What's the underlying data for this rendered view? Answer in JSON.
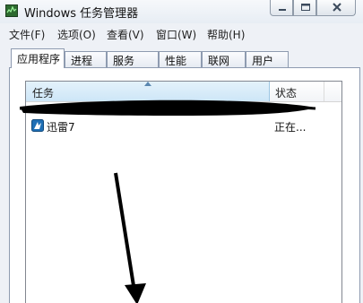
{
  "window": {
    "title": "Windows 任务管理器",
    "icon": "task-manager-icon"
  },
  "caption_buttons": [
    {
      "name": "minimize",
      "icon": "minimize-icon"
    },
    {
      "name": "maximize",
      "icon": "maximize-icon"
    },
    {
      "name": "close",
      "icon": "close-icon"
    }
  ],
  "menu": [
    {
      "label": "文件(F)"
    },
    {
      "label": "选项(O)"
    },
    {
      "label": "查看(V)"
    },
    {
      "label": "窗口(W)"
    },
    {
      "label": "帮助(H)"
    }
  ],
  "tabs": [
    {
      "label": "应用程序",
      "active": true
    },
    {
      "label": "进程",
      "active": false
    },
    {
      "label": "服务",
      "active": false
    },
    {
      "label": "性能",
      "active": false
    },
    {
      "label": "联网",
      "active": false
    },
    {
      "label": "用户",
      "active": false
    }
  ],
  "list": {
    "columns": [
      {
        "label": "任务",
        "sorted": "ascending"
      },
      {
        "label": "状态"
      }
    ],
    "rows": [
      {
        "task": "迅雷7",
        "status": "正在...",
        "icon": "xunlei-icon"
      }
    ]
  },
  "colors": {
    "header_selected": "#cde6f7",
    "chrome_bg": "#eef1f6",
    "annotation": "#000000"
  }
}
